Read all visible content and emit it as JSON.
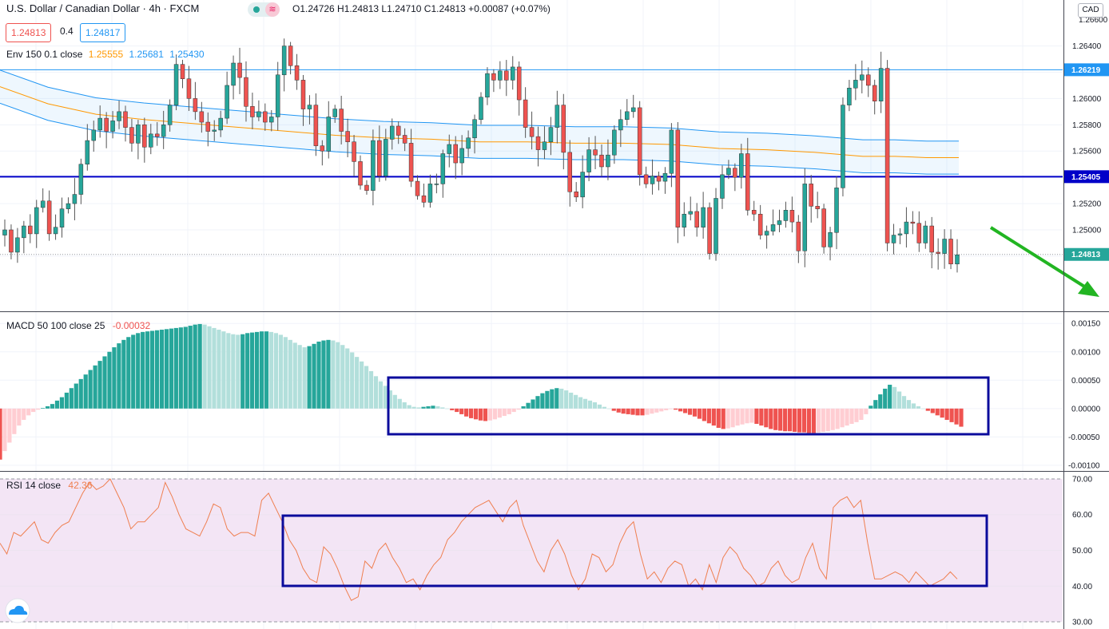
{
  "header": {
    "symbol": "U.S. Dollar / Canadian Dollar · 4h · FXCM",
    "ohlc": "O1.24726 H1.24813 L1.24710 C1.24813 +0.00087 (+0.07%)",
    "bid": "1.24813",
    "spread": "0.4",
    "ask": "1.24817",
    "currency": "CAD"
  },
  "colors": {
    "up": "#26a69a",
    "down": "#ef5350",
    "env_basis": "#ff9800",
    "env_band": "#2196f3",
    "level_line": "#0000c8",
    "annotation": "#0b0b9c",
    "arrow": "#22b522",
    "macd_up_strong": "#26a69a",
    "macd_up_weak": "#b2dfdb",
    "macd_down_strong": "#ef5350",
    "macd_down_weak": "#ffcdd2",
    "rsi_line": "#ef7f50",
    "rsi_band": "#f3e5f5"
  },
  "chart_data": [
    {
      "type": "candlestick",
      "title": "U.S. Dollar / Canadian Dollar · 4h · FXCM",
      "ylim": [
        1.2438,
        1.2675
      ],
      "y_ticks": [
        "1.26400",
        "1.26200",
        "1.26000",
        "1.25800",
        "1.25600",
        "1.25400",
        "1.25200",
        "1.25000",
        "1.24800"
      ],
      "top_tick_label": "1.26600",
      "hlines": [
        {
          "price": 1.26219,
          "label": "1.26219",
          "style": "thin"
        },
        {
          "price": 1.25405,
          "label": "1.25405",
          "style": "thick"
        }
      ],
      "last_price": {
        "price": 1.24813,
        "label": "1.24813"
      },
      "close": [
        1.25,
        1.2483,
        1.2494,
        1.2503,
        1.2497,
        1.2517,
        1.2522,
        1.2497,
        1.2502,
        1.2516,
        1.252,
        1.2527,
        1.255,
        1.2568,
        1.2576,
        1.2585,
        1.2575,
        1.2583,
        1.259,
        1.2578,
        1.2566,
        1.258,
        1.2563,
        1.2573,
        1.2571,
        1.258,
        1.2595,
        1.2626,
        1.2615,
        1.26,
        1.259,
        1.2582,
        1.2575,
        1.2576,
        1.2585,
        1.261,
        1.2627,
        1.2616,
        1.2594,
        1.2586,
        1.259,
        1.2582,
        1.2586,
        1.2618,
        1.264,
        1.2625,
        1.2614,
        1.2592,
        1.2595,
        1.2564,
        1.256,
        1.2586,
        1.2592,
        1.2575,
        1.2567,
        1.2552,
        1.2534,
        1.253,
        1.2568,
        1.2541,
        1.2569,
        1.2579,
        1.2572,
        1.2566,
        1.2537,
        1.2526,
        1.2521,
        1.2535,
        1.2535,
        1.2558,
        1.2565,
        1.2551,
        1.2562,
        1.257,
        1.2584,
        1.2601,
        1.2619,
        1.2614,
        1.2621,
        1.2614,
        1.2624,
        1.2599,
        1.2578,
        1.2571,
        1.2561,
        1.2567,
        1.2578,
        1.2595,
        1.2559,
        1.2529,
        1.2525,
        1.2544,
        1.2561,
        1.2557,
        1.2548,
        1.2557,
        1.2576,
        1.2584,
        1.259,
        1.2593,
        1.2542,
        1.2535,
        1.2541,
        1.2537,
        1.2543,
        1.2576,
        1.2502,
        1.2512,
        1.2514,
        1.2502,
        1.2517,
        1.2482,
        1.2524,
        1.2542,
        1.2547,
        1.254,
        1.2558,
        1.2515,
        1.2512,
        1.2496,
        1.2499,
        1.2504,
        1.2507,
        1.2515,
        1.2506,
        1.2484,
        1.2535,
        1.2518,
        1.2516,
        1.2487,
        1.2498,
        1.2532,
        1.2595,
        1.2608,
        1.2614,
        1.2618,
        1.261,
        1.2598,
        1.2623,
        1.249,
        1.2496,
        1.2497,
        1.2506,
        1.2505,
        1.249,
        1.2503,
        1.2483,
        1.2482,
        1.2493,
        1.2474,
        1.2481
      ],
      "series": [
        {
          "name": "Env 150 0.1 close",
          "values_label": "1.25555",
          "color": "#ff9800"
        },
        {
          "name": "",
          "values_label": "1.25681",
          "color": "#2196f3"
        },
        {
          "name": "",
          "values_label": "1.25430",
          "color": "#2196f3"
        }
      ],
      "envelope_basis": [
        1.2609,
        1.2596,
        1.2588,
        1.2584,
        1.2581,
        1.2578,
        1.2575,
        1.2572,
        1.257,
        1.2569,
        1.2567,
        1.2567,
        1.2566,
        1.2566,
        1.2565,
        1.2562,
        1.2561,
        1.2559,
        1.2556,
        1.2556,
        1.2555,
        1.2555
      ],
      "envelope_x": [
        0,
        60,
        120,
        180,
        240,
        300,
        360,
        420,
        480,
        540,
        600,
        660,
        720,
        780,
        840,
        900,
        960,
        1020,
        1080,
        1120,
        1160,
        1200
      ]
    },
    {
      "type": "bar",
      "title": "MACD 50 100 close 25",
      "value_label": "-0.00032",
      "ylim": [
        -0.0011,
        0.0017
      ],
      "y_ticks": [
        "0.00150",
        "0.00100",
        "0.00050",
        "0.00000",
        "-0.00050",
        "-0.00100"
      ],
      "values": [
        -0.0009,
        -0.00075,
        -0.0006,
        -0.00045,
        -0.0003,
        -0.0002,
        -0.00012,
        -6e-05,
        -2e-05,
        1e-05,
        4e-05,
        8e-05,
        0.00014,
        0.0002,
        0.00028,
        0.00036,
        0.00044,
        0.00052,
        0.0006,
        0.00068,
        0.00076,
        0.00084,
        0.00092,
        0.001,
        0.00108,
        0.00115,
        0.00121,
        0.00126,
        0.0013,
        0.00133,
        0.00135,
        0.00136,
        0.00137,
        0.00138,
        0.00139,
        0.0014,
        0.00141,
        0.00142,
        0.00143,
        0.00144,
        0.00146,
        0.00148,
        0.00149,
        0.00148,
        0.00145,
        0.00142,
        0.00139,
        0.00136,
        0.00133,
        0.00131,
        0.0013,
        0.00131,
        0.00133,
        0.00134,
        0.00135,
        0.00136,
        0.00136,
        0.00135,
        0.00133,
        0.0013,
        0.00126,
        0.00121,
        0.00116,
        0.00112,
        0.00108,
        0.0011,
        0.00114,
        0.00118,
        0.0012,
        0.00121,
        0.0012,
        0.00117,
        0.00112,
        0.00106,
        0.00099,
        0.00091,
        0.00083,
        0.00075,
        0.00066,
        0.00057,
        0.00048,
        0.0004,
        0.00032,
        0.00024,
        0.00017,
        0.00011,
        6e-05,
        3e-05,
        2e-05,
        3e-05,
        4e-05,
        5e-05,
        4e-05,
        2e-05,
        0.0,
        -3e-05,
        -6e-05,
        -0.0001,
        -0.00014,
        -0.00017,
        -0.00019,
        -0.00021,
        -0.00022,
        -0.00021,
        -0.00019,
        -0.00016,
        -0.00013,
        -0.0001,
        -6e-05,
        -2e-05,
        4e-05,
        0.0001,
        0.00016,
        0.00022,
        0.00027,
        0.00031,
        0.00034,
        0.00036,
        0.00035,
        0.00032,
        0.00028,
        0.00024,
        0.0002,
        0.00017,
        0.00014,
        0.00011,
        7e-05,
        3e-05,
        0.0,
        -4e-05,
        -7e-05,
        -9e-05,
        -0.0001,
        -0.00011,
        -0.00012,
        -0.00012,
        -0.00011,
        -9e-05,
        -7e-05,
        -5e-05,
        -3e-05,
        -1e-05,
        -2e-05,
        -5e-05,
        -8e-05,
        -0.00011,
        -0.00014,
        -0.00018,
        -0.00022,
        -0.00026,
        -0.0003,
        -0.00034,
        -0.00036,
        -0.00035,
        -0.00033,
        -0.0003,
        -0.00028,
        -0.00026,
        -0.00025,
        -0.00027,
        -0.0003,
        -0.00033,
        -0.00036,
        -0.00038,
        -0.00039,
        -0.0004,
        -0.0004,
        -0.00041,
        -0.00042,
        -0.00042,
        -0.00043,
        -0.00043,
        -0.00042,
        -0.00041,
        -0.0004,
        -0.00038,
        -0.00036,
        -0.00033,
        -0.0003,
        -0.00027,
        -0.00024,
        -0.0002,
        -0.0001,
        5e-05,
        0.00015,
        0.00025,
        0.00035,
        0.00042,
        0.00038,
        0.0003,
        0.00022,
        0.00015,
        9e-05,
        4e-05,
        0.0,
        -4e-05,
        -8e-05,
        -0.00012,
        -0.00016,
        -0.0002,
        -0.00024,
        -0.00028,
        -0.00032
      ]
    },
    {
      "type": "line",
      "title": "RSI 14 close",
      "value_label": "42.36",
      "ylim": [
        28,
        72
      ],
      "y_ticks": [
        "70.00",
        "60.00",
        "50.00",
        "40.00",
        "30.00"
      ],
      "band": [
        30,
        70
      ],
      "values": [
        52,
        49,
        55,
        54,
        56,
        58,
        53,
        52,
        55,
        57,
        58,
        62,
        66,
        69,
        67,
        68,
        70,
        66,
        62,
        56,
        58,
        58,
        60,
        62,
        69,
        65,
        60,
        56,
        55,
        54,
        58,
        63,
        62,
        56,
        54,
        55,
        55,
        54,
        64,
        66,
        62,
        58,
        53,
        50,
        45,
        42,
        41,
        51,
        49,
        45,
        40,
        36,
        37,
        47,
        45,
        50,
        52,
        48,
        45,
        41,
        42,
        39,
        43,
        46,
        48,
        53,
        55,
        58,
        60,
        62,
        63,
        64,
        61,
        58,
        62,
        64,
        57,
        52,
        47,
        44,
        50,
        53,
        49,
        43,
        39,
        42,
        49,
        48,
        44,
        46,
        52,
        56,
        58,
        49,
        42,
        44,
        41,
        45,
        47,
        46,
        40,
        42,
        39,
        46,
        41,
        48,
        51,
        49,
        45,
        43,
        40,
        41,
        45,
        47,
        43,
        41,
        42,
        48,
        52,
        45,
        42,
        62,
        64,
        65,
        62,
        64,
        52,
        42,
        42,
        43,
        44,
        43,
        41,
        44,
        42,
        40,
        41,
        42,
        44,
        42
      ]
    }
  ],
  "annotations": {
    "macd_box": {
      "label": ""
    },
    "rsi_box": {
      "label": ""
    }
  }
}
